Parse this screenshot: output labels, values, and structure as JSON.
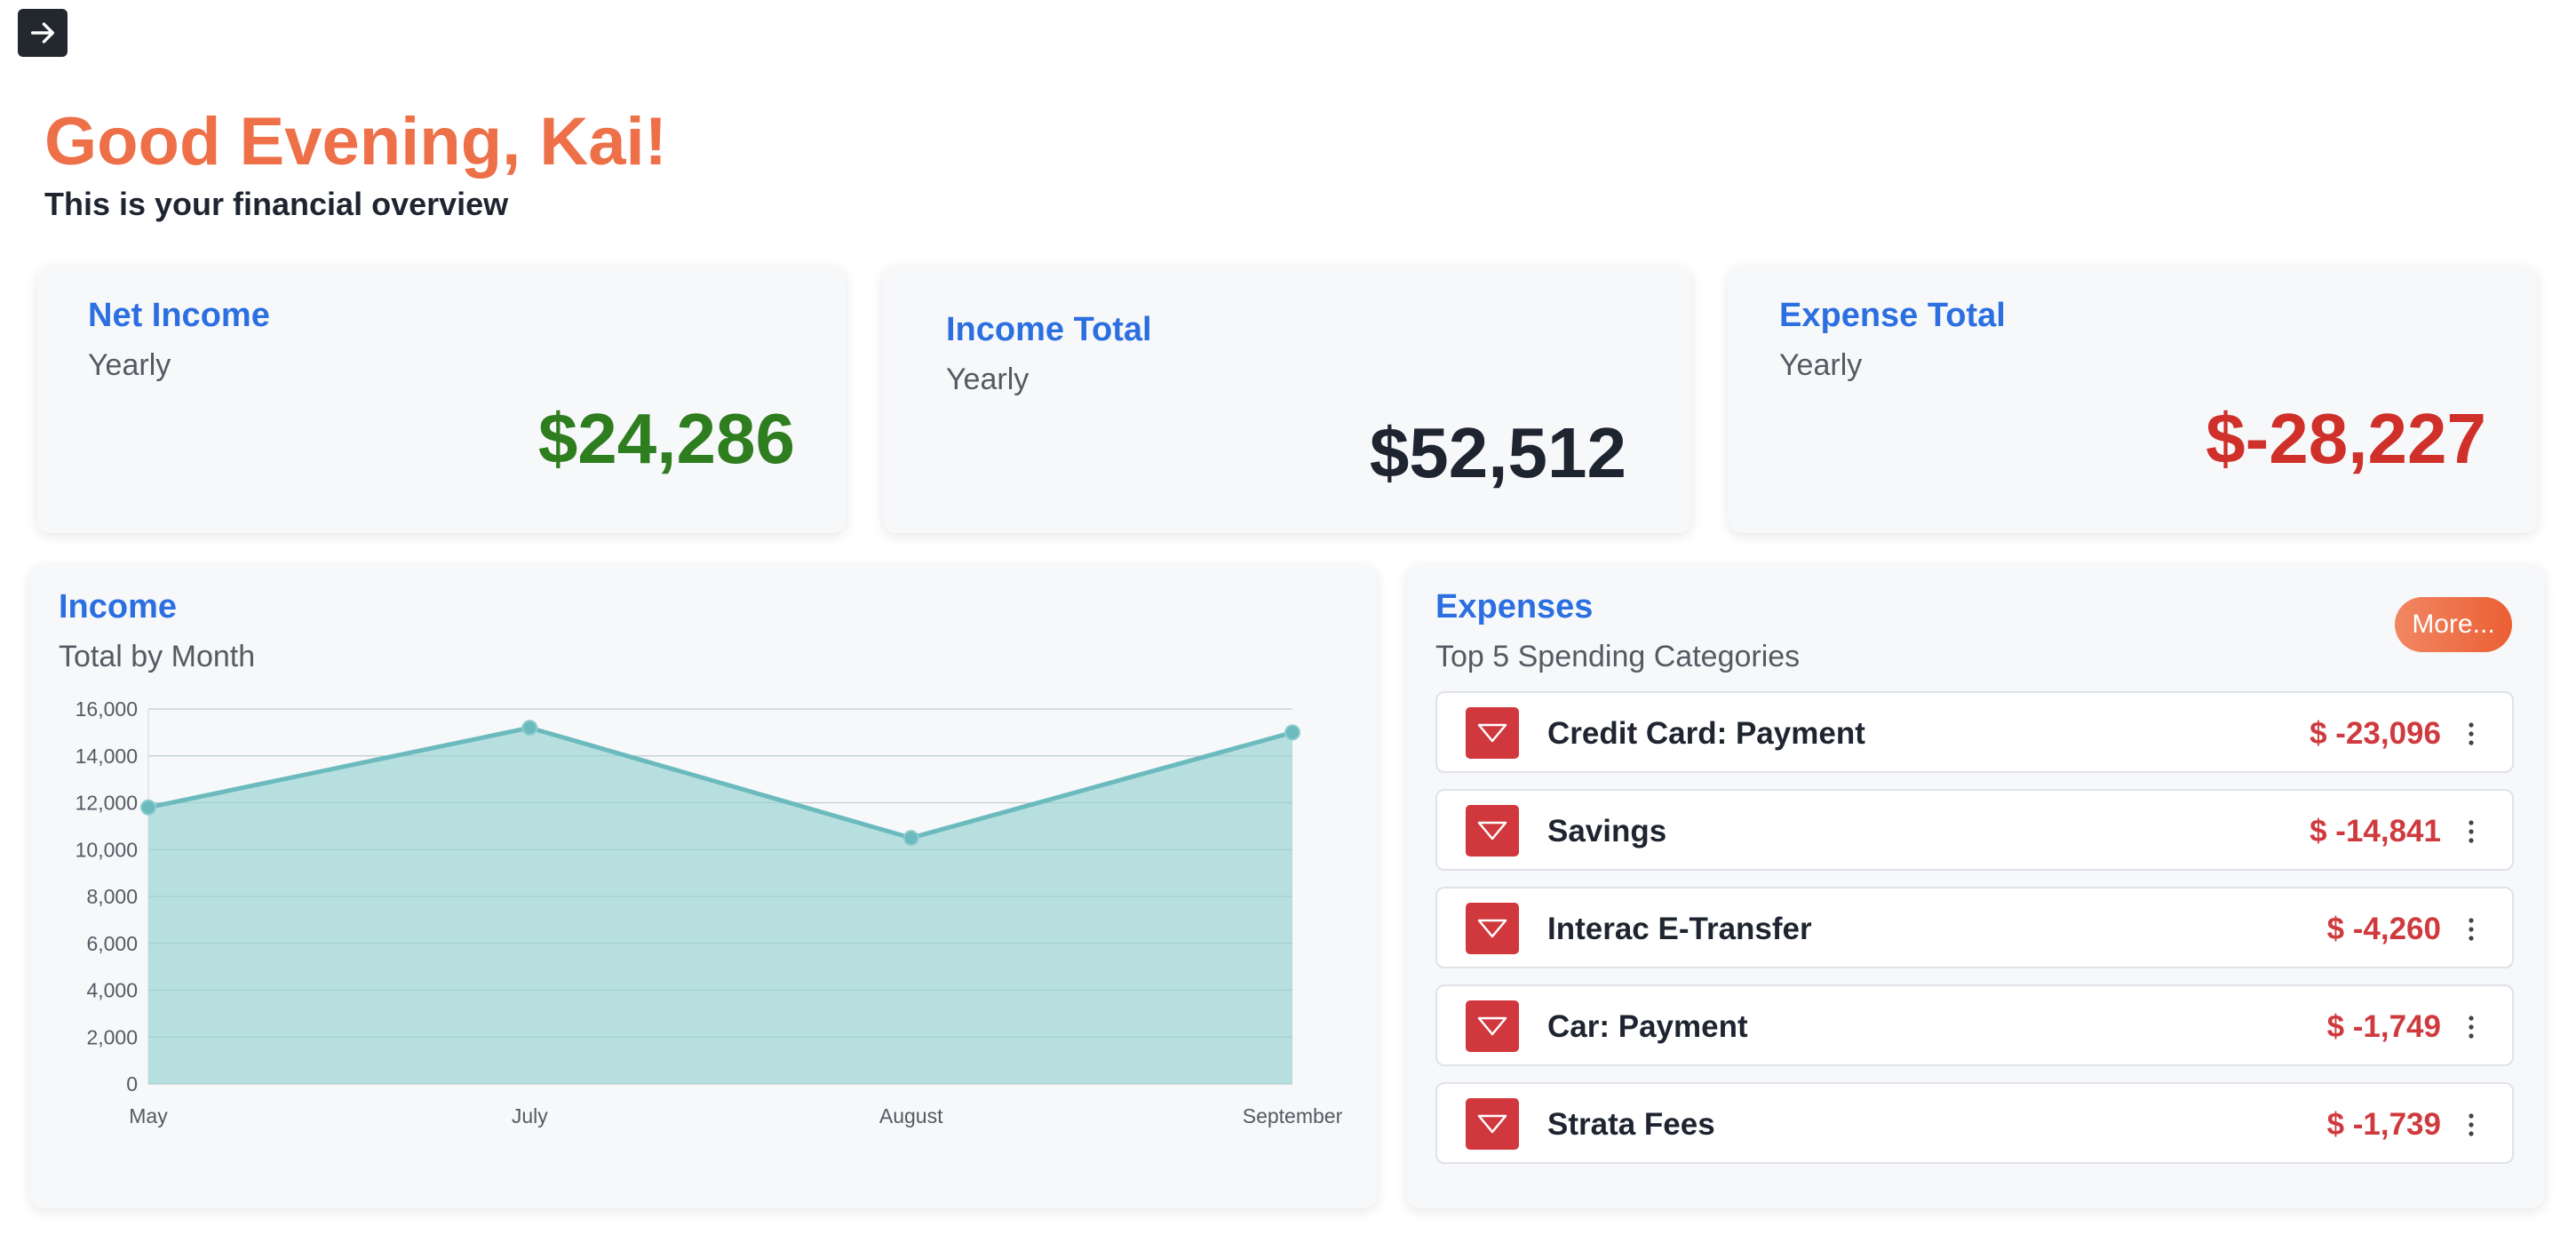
{
  "nav": {
    "icon": "arrow-right-icon"
  },
  "header": {
    "greeting": "Good Evening, Kai!",
    "subtitle": "This is your financial overview"
  },
  "cards": {
    "net_income": {
      "title": "Net Income",
      "period": "Yearly",
      "value": "$24,286",
      "color": "#2e7d1f"
    },
    "income_total": {
      "title": "Income Total",
      "period": "Yearly",
      "value": "$52,512",
      "color": "#1f2530"
    },
    "expense_total": {
      "title": "Expense Total",
      "period": "Yearly",
      "value": "$-28,227",
      "color": "#d0302a"
    }
  },
  "income": {
    "title": "Income",
    "subtitle": "Total by Month"
  },
  "expenses": {
    "title": "Expenses",
    "subtitle": "Top 5 Spending Categories",
    "more_label": "More...",
    "items": [
      {
        "label": "Credit Card: Payment",
        "amount": "$ -23,096",
        "icon": "down-triangle-icon"
      },
      {
        "label": "Savings",
        "amount": "$ -14,841",
        "icon": "down-triangle-icon"
      },
      {
        "label": "Interac E-Transfer",
        "amount": "$ -4,260",
        "icon": "down-triangle-icon"
      },
      {
        "label": "Car: Payment",
        "amount": "$ -1,749",
        "icon": "down-triangle-icon"
      },
      {
        "label": "Strata Fees",
        "amount": "$ -1,739",
        "icon": "down-triangle-icon"
      }
    ]
  },
  "colors": {
    "accent": "#2c6fe0",
    "greeting": "#ee7048",
    "expense_red": "#cf3a3e",
    "chart_line": "#6bbabd",
    "chart_fill": "#b7dfdf"
  },
  "chart_data": {
    "type": "area",
    "categories": [
      "May",
      "July",
      "August",
      "September"
    ],
    "values": [
      11800,
      15200,
      10500,
      15000
    ],
    "ylim": [
      0,
      16000
    ],
    "yticks": [
      0,
      2000,
      4000,
      6000,
      8000,
      10000,
      12000,
      14000,
      16000
    ],
    "ytick_labels": [
      "0",
      "2,000",
      "4,000",
      "6,000",
      "8,000",
      "10,000",
      "12,000",
      "14,000",
      "16,000"
    ],
    "grid": true,
    "legend": "none"
  }
}
